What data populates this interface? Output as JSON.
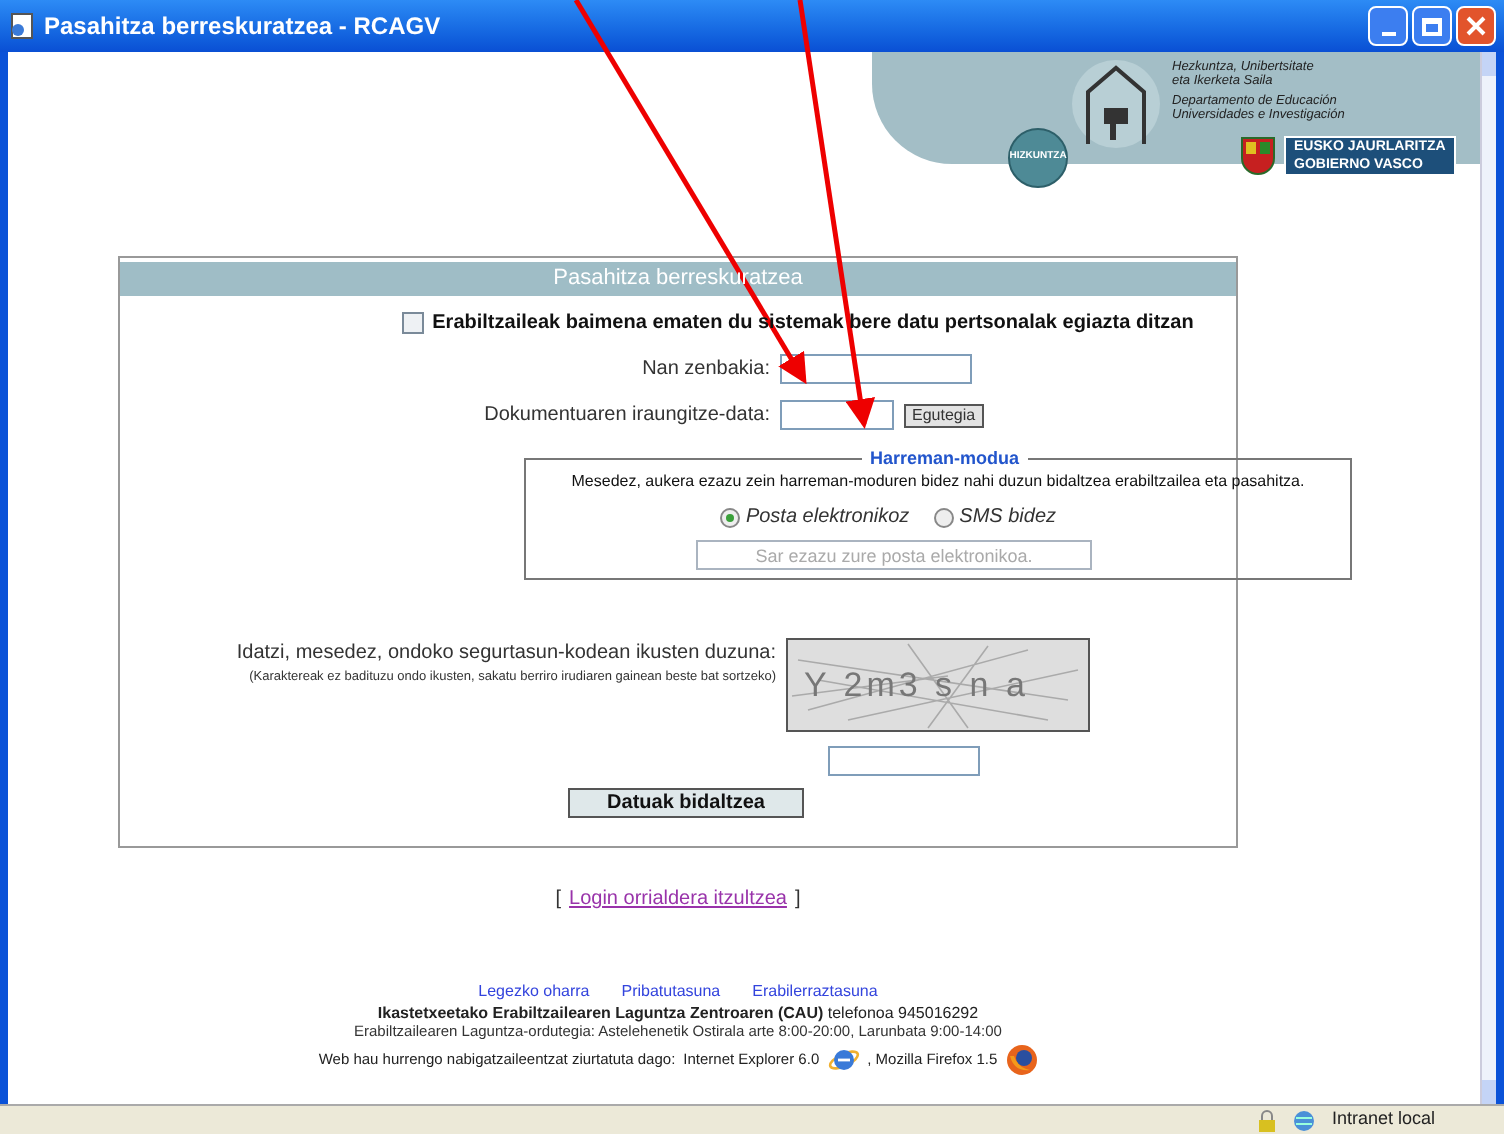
{
  "window": {
    "title": "Pasahitza berreskuratzea - RCAGV"
  },
  "header": {
    "dept_lines": [
      "Hezkuntza, Unibertsitate",
      "eta Ikerketa Saila",
      "Departamento de Educación",
      "Universidades e Investigación"
    ],
    "badge": "HIZKUNTZA",
    "gov_lines": [
      "EUSKO JAURLARITZA",
      "GOBIERNO VASCO"
    ]
  },
  "form": {
    "title": "Pasahitza berreskuratzea",
    "consent": {
      "label": "Erabiltzaileak baimena ematen du sistemak bere datu pertsonalak egiazta ditzan",
      "checked": false
    },
    "fields": [
      {
        "label": "Nan zenbakia:",
        "kind": "text"
      },
      {
        "label": "Dokumentuaren iraungitze-data:",
        "kind": "date",
        "button": "Egutegia"
      }
    ],
    "contact": {
      "legend": "Harreman-modua",
      "prompt": "Mesedez, aukera ezazu zein harreman-moduren bidez nahi duzun bidaltzea erabiltzailea eta pasahitza.",
      "options": [
        {
          "label": "Posta elektronikoz",
          "selected": true
        },
        {
          "label": "SMS bidez",
          "selected": false
        }
      ],
      "email_placeholder": "Sar ezazu zure posta elektronikoa."
    },
    "captcha": {
      "label": "Idatzi, mesedez, ondoko segurtasun-kodean ikusten duzuna:",
      "hint": "(Karaktereak ez badituzu ondo ikusten, sakatu berriro irudiaren gainean beste bat sortzeko)",
      "code": "Y 2m3 s n a"
    },
    "submit": "Datuak bidaltzea"
  },
  "back_link": {
    "open": "[",
    "text": "Login orrialdera itzultzea",
    "close": "]"
  },
  "footer": {
    "links": [
      "Legezko oharra",
      "Pribatutasuna",
      "Erabilerraztasuna"
    ],
    "contact_line": "**Ikastetxeetako Erabiltzailearen Laguntza Zentroaren (CAU)** telefonoa 945016292",
    "hours_line": "Erabiltzailearen Laguntza-ordutegia: Astelehenetik Ostirala arte 8:00-20:00, Larunbata 9:00-14:00",
    "browsers_prefix": "Web hau hurrengo nabigatzaileentzat ziurtatuta dago:",
    "browsers": [
      {
        "name": "Internet Explorer 6.0",
        "kind": "ie"
      },
      {
        "name": ", Mozilla Firefox 1.5",
        "kind": "firefox"
      }
    ]
  },
  "status_bar": {
    "zone": "Intranet local"
  }
}
